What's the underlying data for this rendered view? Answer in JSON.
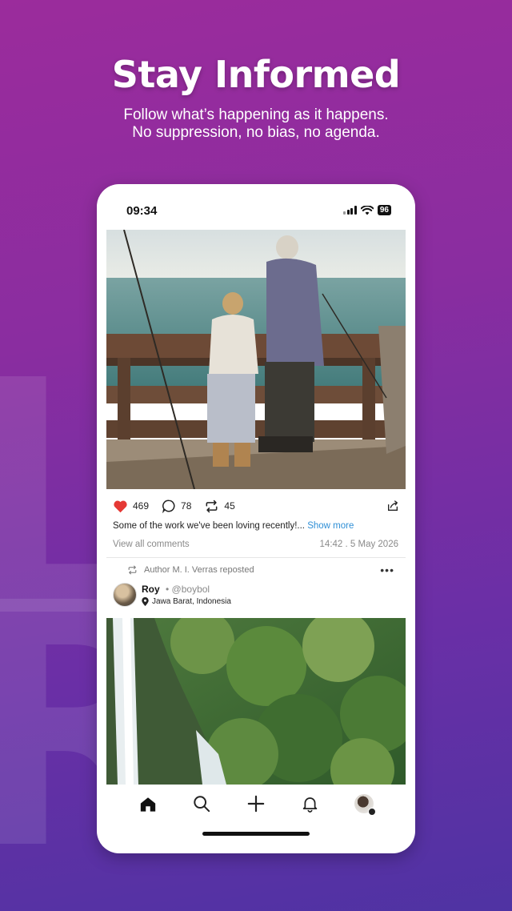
{
  "promo": {
    "headline": "Stay Informed",
    "subline_1": "Follow what’s happening as it happens.",
    "subline_2": "No suppression, no bias, no agenda."
  },
  "status_bar": {
    "time": "09:34",
    "battery": "96"
  },
  "post1": {
    "likes": "469",
    "comments": "78",
    "reposts": "45",
    "caption": "Some of the work we've been loving recently!...",
    "show_more": "Show more",
    "view_comments": "View all comments",
    "timestamp": "14:42 . 5 May 2026",
    "like_color": "#e53935"
  },
  "post2": {
    "repost_label": "Author M. I. Verras reposted",
    "author_name": "Roy",
    "author_handle": "@boybol",
    "location": "Jawa Barat, Indonesia"
  },
  "icons": {
    "heart": "heart-icon",
    "comment": "comment-icon",
    "repost": "repost-icon",
    "share": "share-icon",
    "more": "more-icon",
    "location": "location-pin-icon",
    "home": "home-icon",
    "search": "search-icon",
    "create": "plus-icon",
    "notifications": "bell-icon"
  },
  "colors": {
    "background_top": "#9b2c9c",
    "background_bottom": "#4f33a3",
    "link": "#2f8fd6"
  }
}
